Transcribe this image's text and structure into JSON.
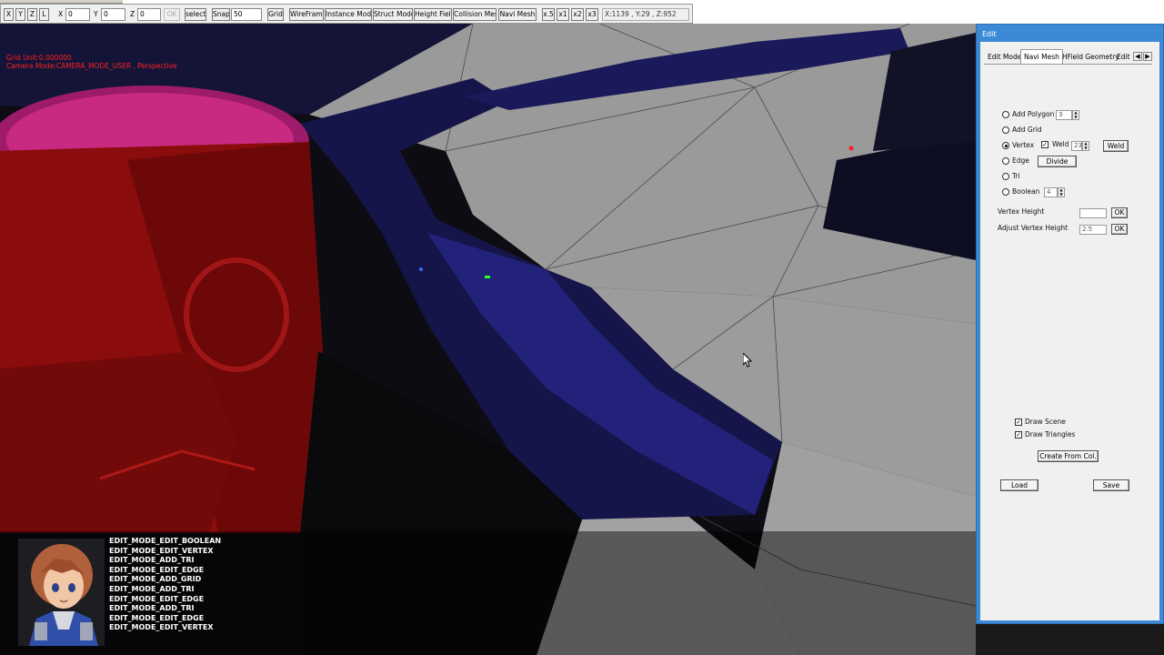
{
  "toolbar": {
    "axis_buttons": [
      "X",
      "Y",
      "Z",
      "L"
    ],
    "x_label": "X",
    "x_value": "0",
    "y_label": "Y",
    "y_value": "0",
    "z_label": "Z",
    "z_value": "0",
    "ok_label": "OK",
    "select_label": "select",
    "snap_label": "Snap",
    "snap_value": "50",
    "grid_label": "Grid",
    "mode_buttons": [
      "WireFrame",
      "Instance Model",
      "Struct Model",
      "Height Field",
      "Collision Mesh",
      "Navi Mesh"
    ],
    "scale_buttons": [
      "x.5",
      "x1",
      "x2",
      "x3"
    ],
    "coords": "X:1139 , Y:29 , Z:952"
  },
  "viewport": {
    "grid_unit": "Grid Unit:0.000000",
    "camera_mode": "Camera Mode:CAMERA_MODE_USER , Perspective",
    "log_lines": [
      "EDIT_MODE_EDIT_BOOLEAN",
      "EDIT_MODE_EDIT_VERTEX",
      "EDIT_MODE_ADD_TRI",
      "EDIT_MODE_EDIT_EDGE",
      "EDIT_MODE_ADD_GRID",
      "EDIT_MODE_ADD_TRI",
      "EDIT_MODE_EDIT_EDGE",
      "EDIT_MODE_ADD_TRI",
      "EDIT_MODE_EDIT_EDGE",
      "EDIT_MODE_EDIT_VERTEX"
    ]
  },
  "edit_window": {
    "title": "Edit",
    "tabs": [
      "Edit Model",
      "Navi Mesh",
      "HField Geometry",
      "Edit W"
    ],
    "active_tab": "Navi Mesh",
    "add_polygon_label": "Add Polygon",
    "add_polygon_value": "3",
    "add_grid_label": "Add Grid",
    "vertex_label": "Vertex",
    "weld_check_label": "Weld",
    "weld_value": "23",
    "weld_button": "Weld",
    "edge_label": "Edge",
    "divide_button": "Divide",
    "tri_label": "Tri",
    "boolean_label": "Boolean",
    "boolean_value": "4",
    "vertex_height_label": "Vertex Height",
    "vertex_height_value": "",
    "vertex_height_ok": "OK",
    "adjust_height_label": "Adjust Vertex Height",
    "adjust_height_value": "2.5",
    "adjust_height_ok": "OK",
    "draw_scene_label": "Draw Scene",
    "draw_triangles_label": "Draw Triangles",
    "create_from_col_button": "Create From Col.",
    "load_button": "Load",
    "save_button": "Save"
  },
  "colors": {
    "titlebar": "#3c8ad6",
    "hud_text": "#ff2020",
    "navmesh_fill": "#9a9a9a"
  }
}
